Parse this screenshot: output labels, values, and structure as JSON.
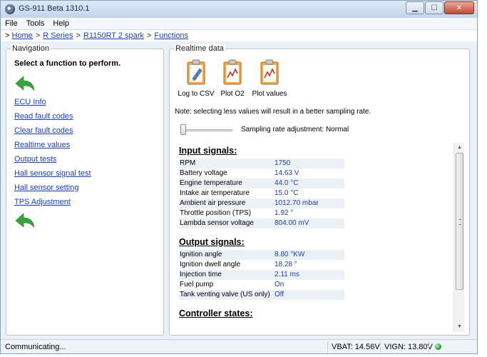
{
  "window": {
    "title": "GS-911 Beta 1310.1"
  },
  "menu": [
    "File",
    "Tools",
    "Help"
  ],
  "breadcrumb": {
    "prefix": ">",
    "items": [
      "Home",
      "R Series",
      "R1150RT 2 spark",
      "Functions"
    ],
    "separator": ">"
  },
  "navigation": {
    "title": "Navigation",
    "heading": "Select a function to perform.",
    "links": [
      "ECU Info",
      "Read fault codes",
      "Clear fault codes",
      "Realtime values",
      "Output tests",
      "Hall sensor signal test",
      "Hall sensor setting",
      "TPS Adjustment"
    ]
  },
  "realtime": {
    "title": "Realtime data",
    "tools": [
      "Log to CSV",
      "Plot O2",
      "Plot values"
    ],
    "note": "Note: selecting less values will result in a better sampling rate.",
    "sampling_label": "Sampling rate adjustment: Normal",
    "input_title": "Input signals:",
    "input": [
      {
        "label": "RPM",
        "value": "1750"
      },
      {
        "label": "Battery voltage",
        "value": "14.63 V"
      },
      {
        "label": "Engine temperature",
        "value": "44.0 °C"
      },
      {
        "label": "Intake air temperature",
        "value": "15.0 °C"
      },
      {
        "label": "Ambient air pressure",
        "value": "1012.70 mbar"
      },
      {
        "label": "Throttle position (TPS)",
        "value": "1.92 °"
      },
      {
        "label": "Lambda sensor voltage",
        "value": "804.00 mV"
      }
    ],
    "output_title": "Output signals:",
    "output": [
      {
        "label": "Ignition angle",
        "value": "8.80 °KW"
      },
      {
        "label": "Ignition dwell angle",
        "value": "18.28 °"
      },
      {
        "label": "Injection time",
        "value": "2.11 ms"
      },
      {
        "label": "Fuel pump",
        "value": "On"
      },
      {
        "label": "Tank venting valve (US only)",
        "value": "Off"
      }
    ],
    "controller_title": "Controller states:"
  },
  "status": {
    "text": "Communicating...",
    "vbat": "VBAT: 14.56V",
    "vign": "VIGN: 13.80V"
  },
  "colors": {
    "link": "#1a3fbf",
    "arrow": "#3aa43c",
    "led": "#2aa533"
  }
}
